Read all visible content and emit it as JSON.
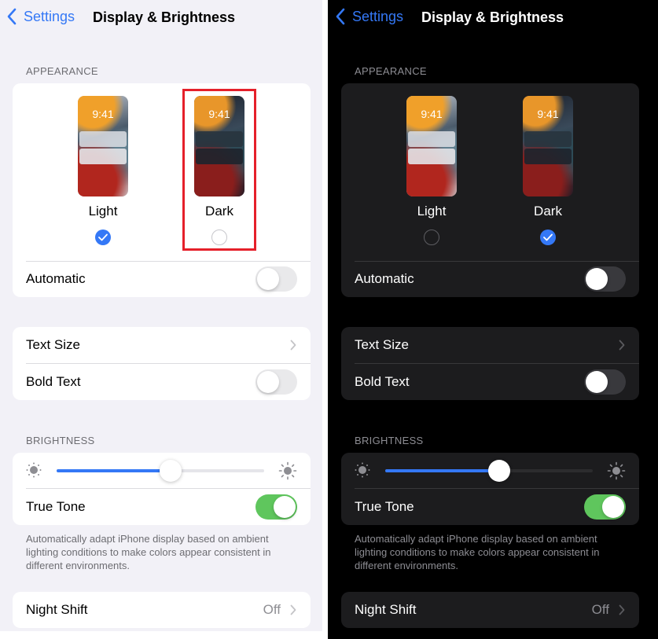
{
  "panels": {
    "light": {
      "theme": "light",
      "nav": {
        "back_label": "Settings",
        "title": "Display & Brightness"
      },
      "appearance": {
        "header": "APPEARANCE",
        "options": [
          {
            "label": "Light",
            "time": "9:41",
            "selected": true
          },
          {
            "label": "Dark",
            "time": "9:41",
            "selected": false
          }
        ],
        "automatic": {
          "label": "Automatic",
          "on": false
        }
      },
      "text": {
        "text_size": {
          "label": "Text Size"
        },
        "bold_text": {
          "label": "Bold Text",
          "on": false
        }
      },
      "brightness": {
        "header": "BRIGHTNESS",
        "level": 0.55,
        "true_tone": {
          "label": "True Tone",
          "on": true
        },
        "footnote": "Automatically adapt iPhone display based on ambient lighting conditions to make colors appear consistent in different environments."
      },
      "night_shift": {
        "label": "Night Shift",
        "value": "Off"
      },
      "highlight": "Dark option outlined in red"
    },
    "dark": {
      "theme": "dark",
      "nav": {
        "back_label": "Settings",
        "title": "Display & Brightness"
      },
      "appearance": {
        "header": "APPEARANCE",
        "options": [
          {
            "label": "Light",
            "time": "9:41",
            "selected": false
          },
          {
            "label": "Dark",
            "time": "9:41",
            "selected": true
          }
        ],
        "automatic": {
          "label": "Automatic",
          "on": false
        }
      },
      "text": {
        "text_size": {
          "label": "Text Size"
        },
        "bold_text": {
          "label": "Bold Text",
          "on": false
        }
      },
      "brightness": {
        "header": "BRIGHTNESS",
        "level": 0.55,
        "true_tone": {
          "label": "True Tone",
          "on": true
        },
        "footnote": "Automatically adapt iPhone display based on ambient lighting conditions to make colors appear consistent in different environments."
      },
      "night_shift": {
        "label": "Night Shift",
        "value": "Off"
      }
    }
  },
  "colors": {
    "accent": "#3478f6",
    "toggle_on": "#5fc65d",
    "highlight_box": "#e5202a",
    "light_bg": "#f2f1f7",
    "dark_bg": "#000000",
    "dark_cell": "#1c1c1e"
  }
}
